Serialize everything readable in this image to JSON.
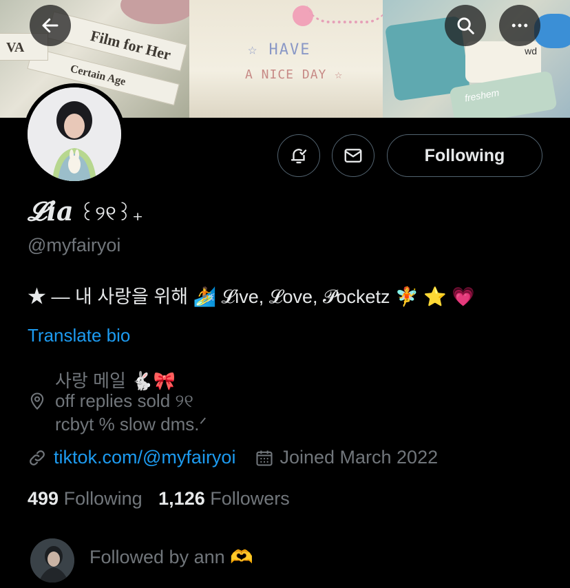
{
  "header": {
    "back_icon": "arrow-left-icon",
    "search_icon": "search-icon",
    "more_icon": "ellipsis-icon",
    "banner_texts": {
      "book1": "Film for Her",
      "book2": "Certain Age",
      "book3": "VA",
      "shirt_line1": "☆ HAVE",
      "shirt_line2": "A NICE DAY ☆",
      "card1": "wd",
      "card2": "freshem"
    }
  },
  "profile": {
    "name": "𝓛ia",
    "name_deco": "꒰୨୧꒱₊",
    "handle": "@myfairyoi",
    "bio": "★ — 내 사랑을 위해 🏄 𝓛ive, 𝓛ove, 𝓟ocketz 🧚 ⭐ 💗",
    "translate_label": "Translate bio",
    "location_lines": [
      "사랑 메일 🐇🎀",
      "off replies sold ୨୧",
      "rcbyt % slow dms.ᐟ"
    ],
    "link": "tiktok.com/@myfairyoi",
    "joined": "Joined March 2022"
  },
  "actions": {
    "notify_icon": "bell-check-icon",
    "message_icon": "mail-icon",
    "following_label": "Following"
  },
  "stats": {
    "following_count": "499",
    "following_label": "Following",
    "followers_count": "1,126",
    "followers_label": "Followers"
  },
  "followed_by": {
    "text": "Followed by ann 🫶"
  },
  "colors": {
    "background": "#000000",
    "text_primary": "#e7e9ea",
    "text_secondary": "#71767b",
    "accent": "#1d9bf0",
    "border": "#536471"
  }
}
